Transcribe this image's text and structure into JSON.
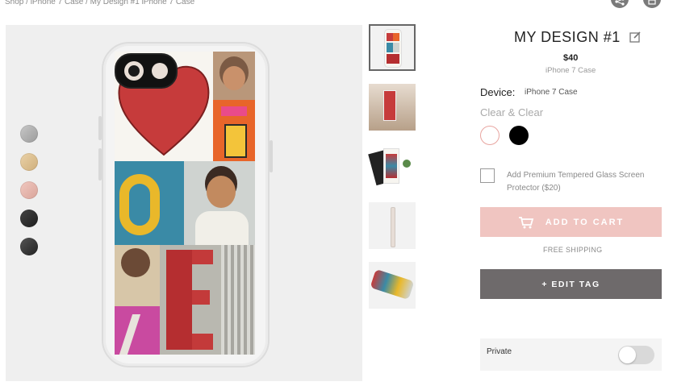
{
  "breadcrumb": {
    "items": [
      "Shop",
      "iPhone 7 Case",
      "My Design #1 iPhone 7 Case"
    ],
    "separator": "/"
  },
  "header_icons": [
    "share-icon",
    "cart-icon"
  ],
  "preview": {
    "colors": {
      "background": "#efefef",
      "swatches": [
        "#a9a9a9",
        "#d9bb8d",
        "#e6b6ad",
        "#2b2b2b",
        "#333333"
      ]
    },
    "swatch_names": [
      "silver",
      "gold",
      "rose-gold",
      "black",
      "jet-black"
    ]
  },
  "thumbnails": [
    {
      "name": "thumb-front"
    },
    {
      "name": "thumb-lifestyle"
    },
    {
      "name": "thumb-packaging"
    },
    {
      "name": "thumb-side"
    },
    {
      "name": "thumb-flat"
    }
  ],
  "product": {
    "title": "MY DESIGN #1",
    "edit_icon": "edit-icon",
    "price": "$40",
    "subtitle": "iPhone 7 Case",
    "device_label": "Device:",
    "device_value": "iPhone 7 Case",
    "finish_label": "Clear & Clear",
    "finish_options": [
      {
        "name": "clear",
        "color": "#ffffff",
        "border": "#e8a5a0",
        "selected": true
      },
      {
        "name": "black",
        "color": "#000000",
        "border": "#000000",
        "selected": false
      }
    ],
    "addon_label": "Add Premium Tempered Glass Screen Protector ($20)",
    "addon_checked": false
  },
  "actions": {
    "add_to_cart": "ADD TO CART",
    "add_to_cart_color": "#f0c5c1",
    "shipping_note": "FREE SHIPPING",
    "edit_tag": "+ EDIT TAG",
    "edit_tag_color": "#6e6a6b"
  },
  "privacy": {
    "label": "Private",
    "enabled": false
  }
}
